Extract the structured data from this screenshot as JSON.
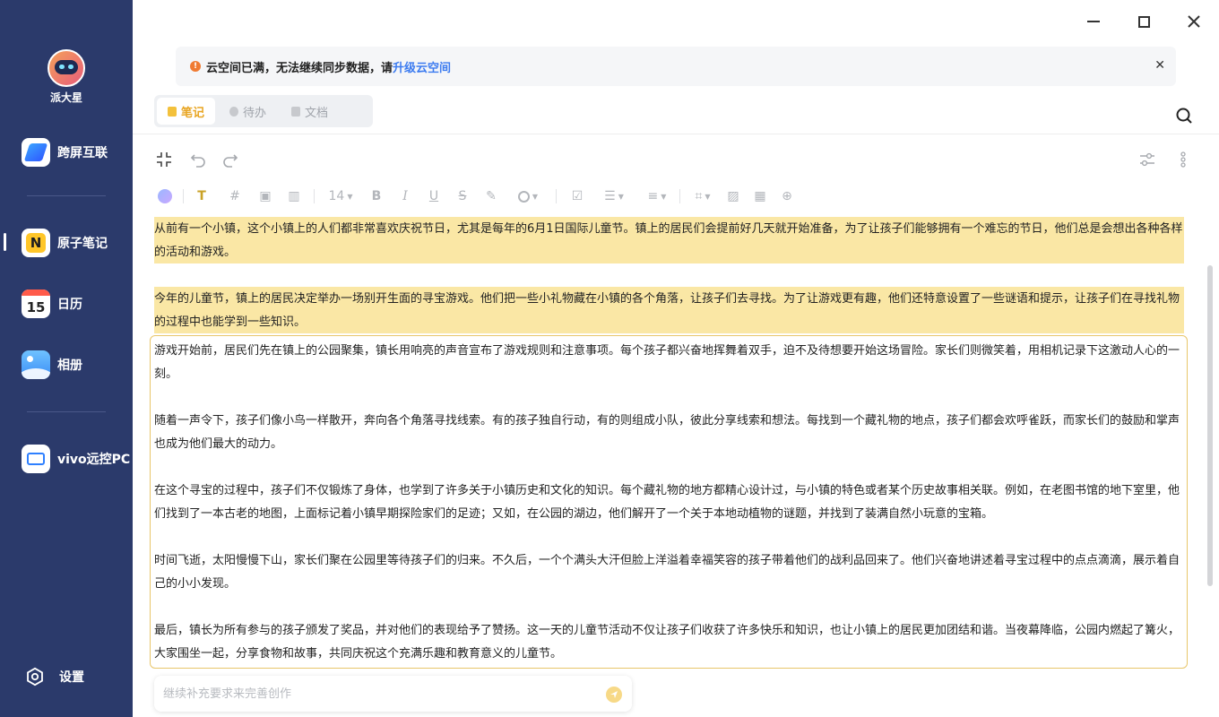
{
  "user": {
    "name": "派大星"
  },
  "sidebar": {
    "items": [
      {
        "label": "跨屏互联",
        "icon": "cross-screen-icon"
      },
      {
        "label": "原子笔记",
        "icon": "notes-app-icon"
      },
      {
        "label": "日历",
        "icon": "calendar-icon",
        "day": "15"
      },
      {
        "label": "相册",
        "icon": "album-icon"
      },
      {
        "label": "vivo远控PC",
        "icon": "remote-pc-icon"
      }
    ],
    "settings_label": "设置"
  },
  "banner": {
    "text": "云空间已满，无法继续同步数据，请",
    "link": "升级云空间"
  },
  "tabs": [
    {
      "label": "笔记",
      "active": true
    },
    {
      "label": "待办",
      "active": false
    },
    {
      "label": "文档",
      "active": false
    }
  ],
  "toolbar": {
    "font_size": "14"
  },
  "content": {
    "paragraphs": [
      "从前有一个小镇，这个小镇上的人们都非常喜欢庆祝节日，尤其是每年的6月1日国际儿童节。镇上的居民们会提前好几天就开始准备，为了让孩子们能够拥有一个难忘的节日，他们总是会想出各种各样的活动和游戏。",
      "今年的儿童节，镇上的居民决定举办一场别开生面的寻宝游戏。他们把一些小礼物藏在小镇的各个角落，让孩子们去寻找。为了让游戏更有趣，他们还特意设置了一些谜语和提示，让孩子们在寻找礼物的过程中也能学到一些知识。",
      "游戏开始前，居民们先在镇上的公园聚集，镇长用响亮的声音宣布了游戏规则和注意事项。每个孩子都兴奋地挥舞着双手，迫不及待想要开始这场冒险。家长们则微笑着，用相机记录下这激动人心的一刻。",
      "随着一声令下，孩子们像小鸟一样散开，奔向各个角落寻找线索。有的孩子独自行动，有的则组成小队，彼此分享线索和想法。每找到一个藏礼物的地点，孩子们都会欢呼雀跃，而家长们的鼓励和掌声也成为他们最大的动力。",
      "在这个寻宝的过程中，孩子们不仅锻炼了身体，也学到了许多关于小镇历史和文化的知识。每个藏礼物的地方都精心设计过，与小镇的特色或者某个历史故事相关联。例如，在老图书馆的地下室里，他们找到了一本古老的地图，上面标记着小镇早期探险家们的足迹；又如，在公园的湖边，他们解开了一个关于本地动植物的谜题，并找到了装满自然小玩意的宝箱。",
      "时间飞逝，太阳慢慢下山，家长们聚在公园里等待孩子们的归来。不久后，一个个满头大汗但脸上洋溢着幸福笑容的孩子带着他们的战利品回来了。他们兴奋地讲述着寻宝过程中的点点滴滴，展示着自己的小小发现。",
      "最后，镇长为所有参与的孩子颁发了奖品，并对他们的表现给予了赞扬。这一天的儿童节活动不仅让孩子们收获了许多快乐和知识，也让小镇上的居民更加团结和谐。当夜幕降临，公园内燃起了篝火，大家围坐一起，分享食物和故事，共同庆祝这个充满乐趣和教育意义的儿童节。"
    ]
  },
  "prompt": {
    "placeholder": "继续补充要求来完善创作"
  },
  "colors": {
    "sidebar": "#2b3a6b",
    "highlight": "#fae7a5",
    "accent": "#e8a522",
    "link": "#3c7bf0"
  }
}
